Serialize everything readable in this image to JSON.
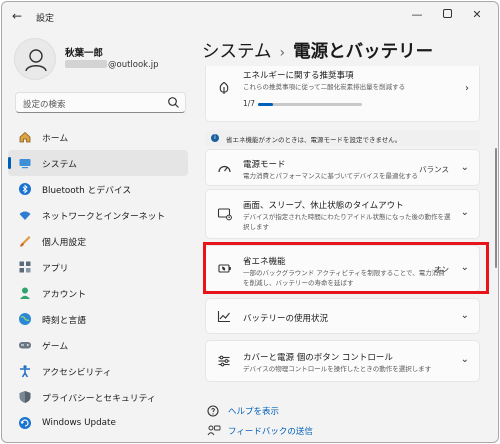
{
  "window": {
    "title": "設定",
    "back_icon": "back-arrow-icon",
    "minimize_glyph": "—",
    "close_glyph": "✕"
  },
  "user": {
    "name": "秋葉一郎",
    "email_suffix": "@outlook.jp"
  },
  "search": {
    "placeholder": "設定の検索"
  },
  "nav": [
    {
      "label": "ホーム",
      "icon": "home-icon",
      "active": false
    },
    {
      "label": "システム",
      "icon": "system-icon",
      "active": true
    },
    {
      "label": "Bluetooth とデバイス",
      "icon": "bluetooth-icon",
      "active": false
    },
    {
      "label": "ネットワークとインターネット",
      "icon": "wifi-icon",
      "active": false
    },
    {
      "label": "個人用設定",
      "icon": "brush-icon",
      "active": false
    },
    {
      "label": "アプリ",
      "icon": "apps-icon",
      "active": false
    },
    {
      "label": "アカウント",
      "icon": "account-icon",
      "active": false
    },
    {
      "label": "時刻と言語",
      "icon": "globe-icon",
      "active": false
    },
    {
      "label": "ゲーム",
      "icon": "gamepad-icon",
      "active": false
    },
    {
      "label": "アクセシビリティ",
      "icon": "accessibility-icon",
      "active": false
    },
    {
      "label": "プライバシーとセキュリティ",
      "icon": "shield-icon",
      "active": false
    },
    {
      "label": "Windows Update",
      "icon": "update-icon",
      "active": false
    }
  ],
  "page": {
    "breadcrumb_parent": "システム",
    "breadcrumb_separator": "›",
    "breadcrumb_current": "電源とバッテリー"
  },
  "cards": {
    "energy": {
      "title": "エネルギーに関する推奨事項",
      "desc": "これらの推奨事項に従って二酸化炭素排出量を削減する",
      "progress_label": "1/7",
      "progress_fraction": 0.14
    },
    "notice": {
      "text": "省エネ機能がオンのときは、電源モードを設定できません。"
    },
    "power_mode": {
      "title": "電源モード",
      "desc": "電力消費とパフォーマンスに基づいてデバイスを最適化する",
      "value": "バランス"
    },
    "sleep": {
      "title": "画面、スリープ、休止状態のタイムアウト",
      "desc1": "デバイスが指定された時間にわたりアイドル状態になった後の動作を選",
      "desc2": "択します"
    },
    "saver": {
      "title": "省エネ機能",
      "desc1": "一部のバックグラウンド アクティビティを制限することで、電力消費",
      "desc2": "を削減し、バッテリーの寿命を延ばす",
      "value": "オン"
    },
    "usage": {
      "title": "バッテリーの使用状況"
    },
    "lid": {
      "title": "カバーと電源 個のボタン コントロール",
      "desc": "デバイスの物理コントロールを操作したときの動作を選択します"
    }
  },
  "links": {
    "help": "ヘルプを表示",
    "feedback": "フィードバックの送信"
  },
  "colors": {
    "accent": "#005fb8",
    "highlight": "#e8141a"
  }
}
